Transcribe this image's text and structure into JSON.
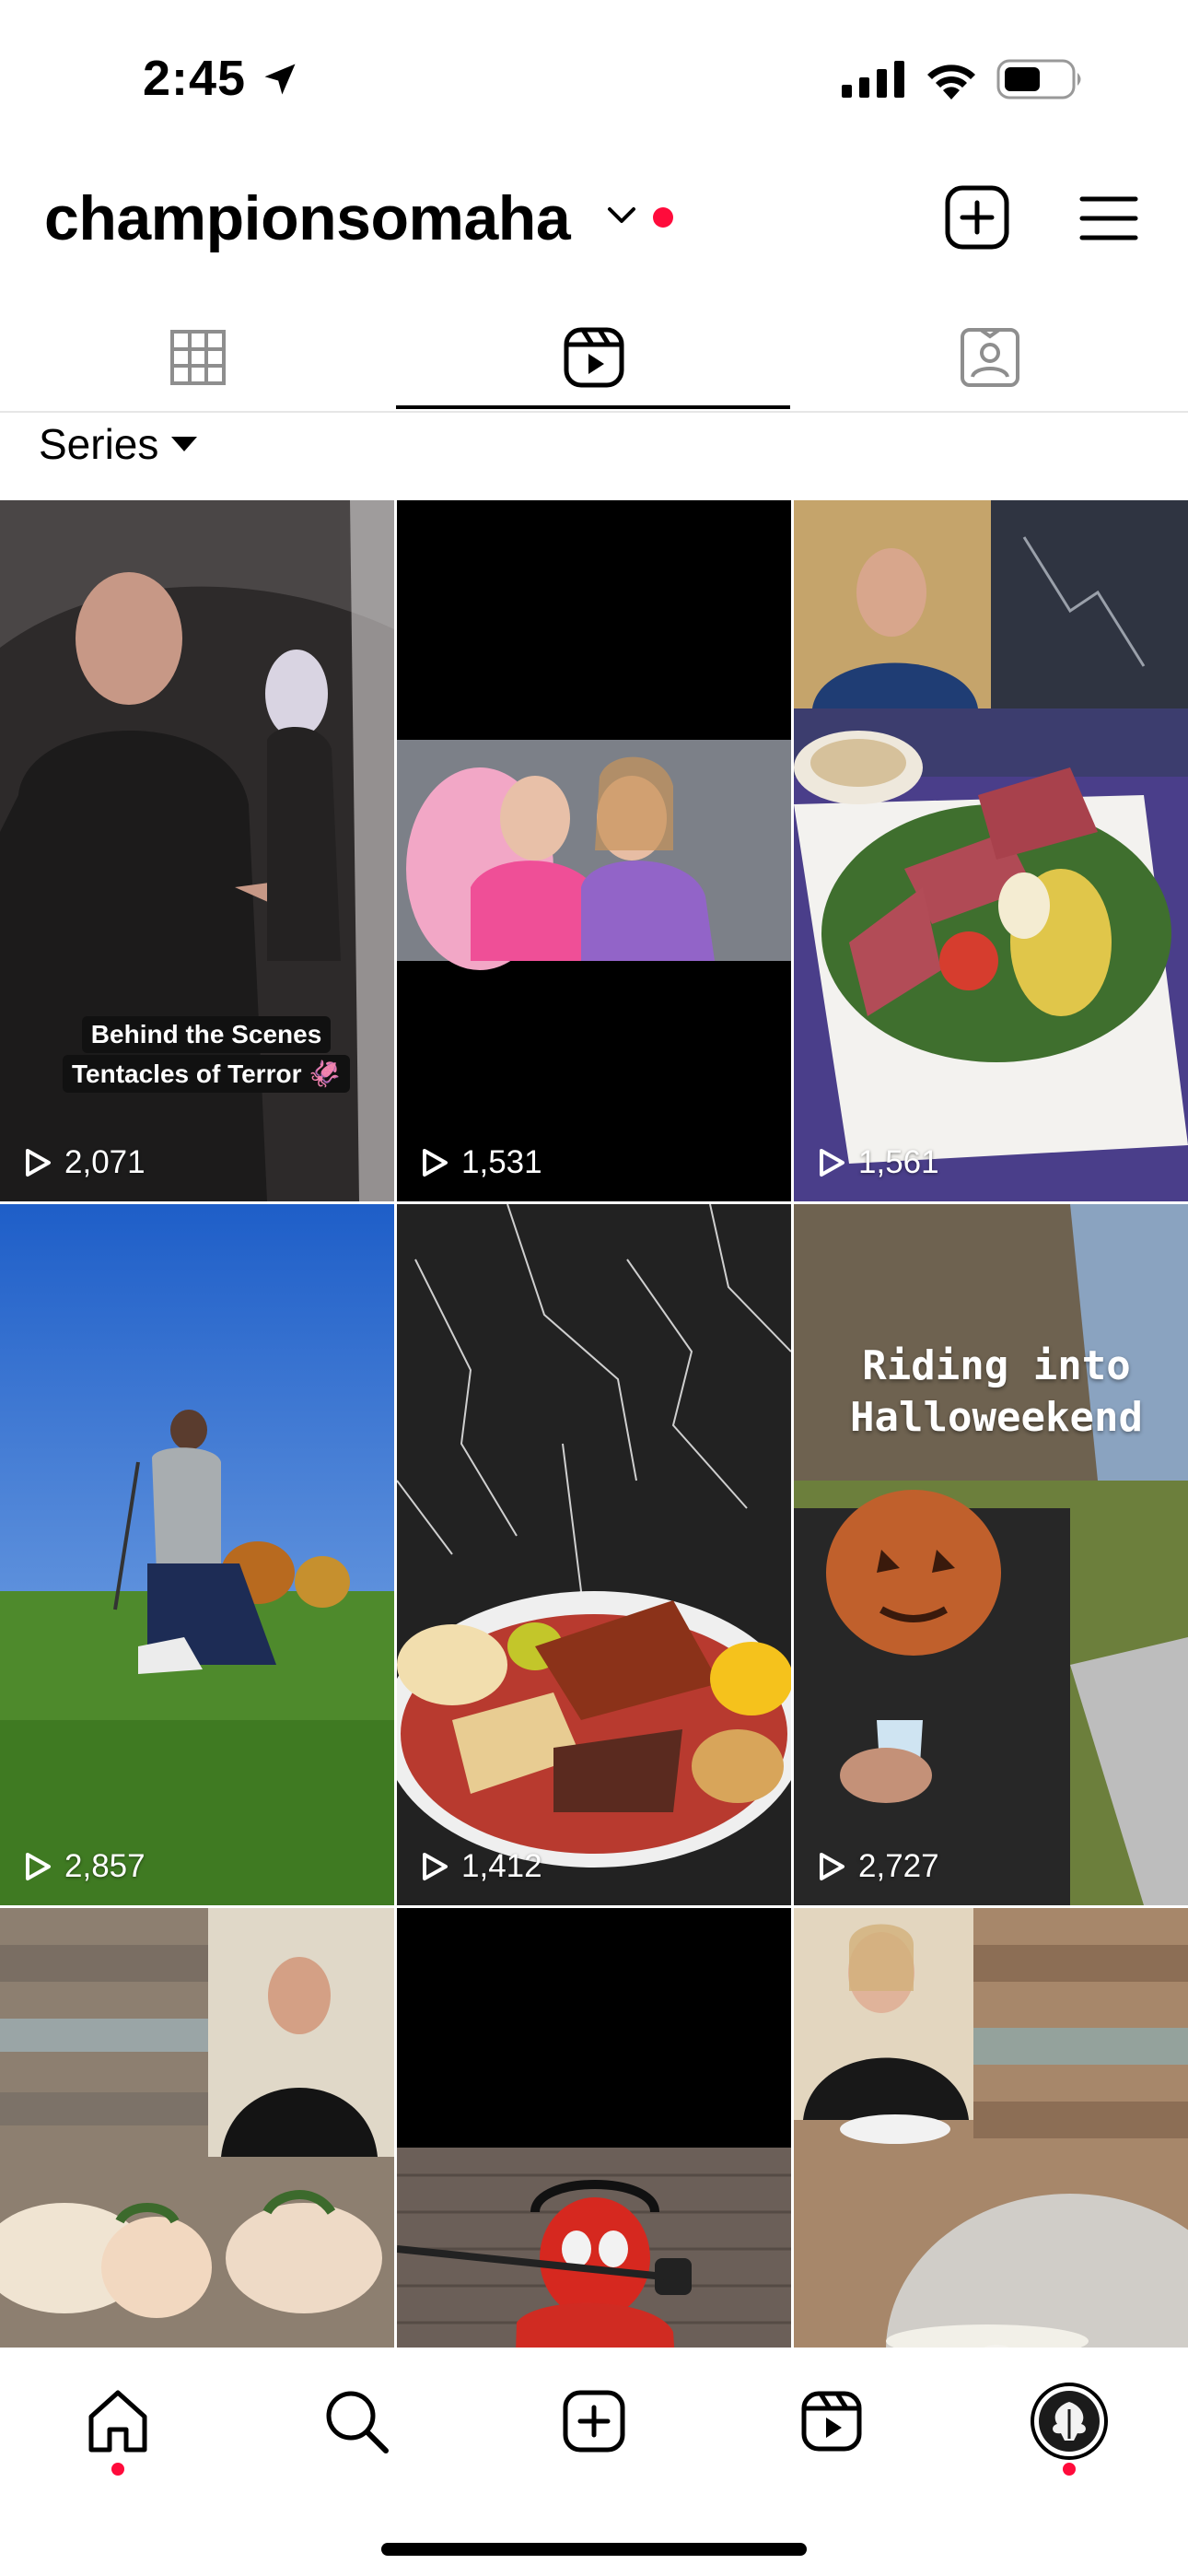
{
  "status_bar": {
    "time": "2:45"
  },
  "header": {
    "username": "championsomaha"
  },
  "tabs": [
    {
      "name": "grid",
      "icon": "grid-icon"
    },
    {
      "name": "reels",
      "icon": "reels-icon",
      "active": true
    },
    {
      "name": "tagged",
      "icon": "tagged-icon"
    }
  ],
  "filter": {
    "label": "Series"
  },
  "reels": [
    {
      "views": "2,071",
      "caption": [
        "Behind the Scenes",
        "Tentacles of Terror 🦑"
      ]
    },
    {
      "views": "1,531"
    },
    {
      "views": "1,561"
    },
    {
      "views": "2,857"
    },
    {
      "views": "1,412"
    },
    {
      "views": "2,727",
      "overlay": "Riding into Halloweekend"
    },
    {
      "views": ""
    },
    {
      "views": ""
    },
    {
      "views": ""
    }
  ],
  "colors": {
    "notification_dot": "#ff0b3b",
    "active_tab": "#000000",
    "inactive_icon": "#8e8e8e"
  },
  "bottom_nav": [
    {
      "name": "home",
      "icon": "home-icon"
    },
    {
      "name": "search",
      "icon": "search-icon"
    },
    {
      "name": "create",
      "icon": "plus-square-icon"
    },
    {
      "name": "reels",
      "icon": "reels-icon"
    },
    {
      "name": "profile",
      "icon": "avatar"
    }
  ]
}
